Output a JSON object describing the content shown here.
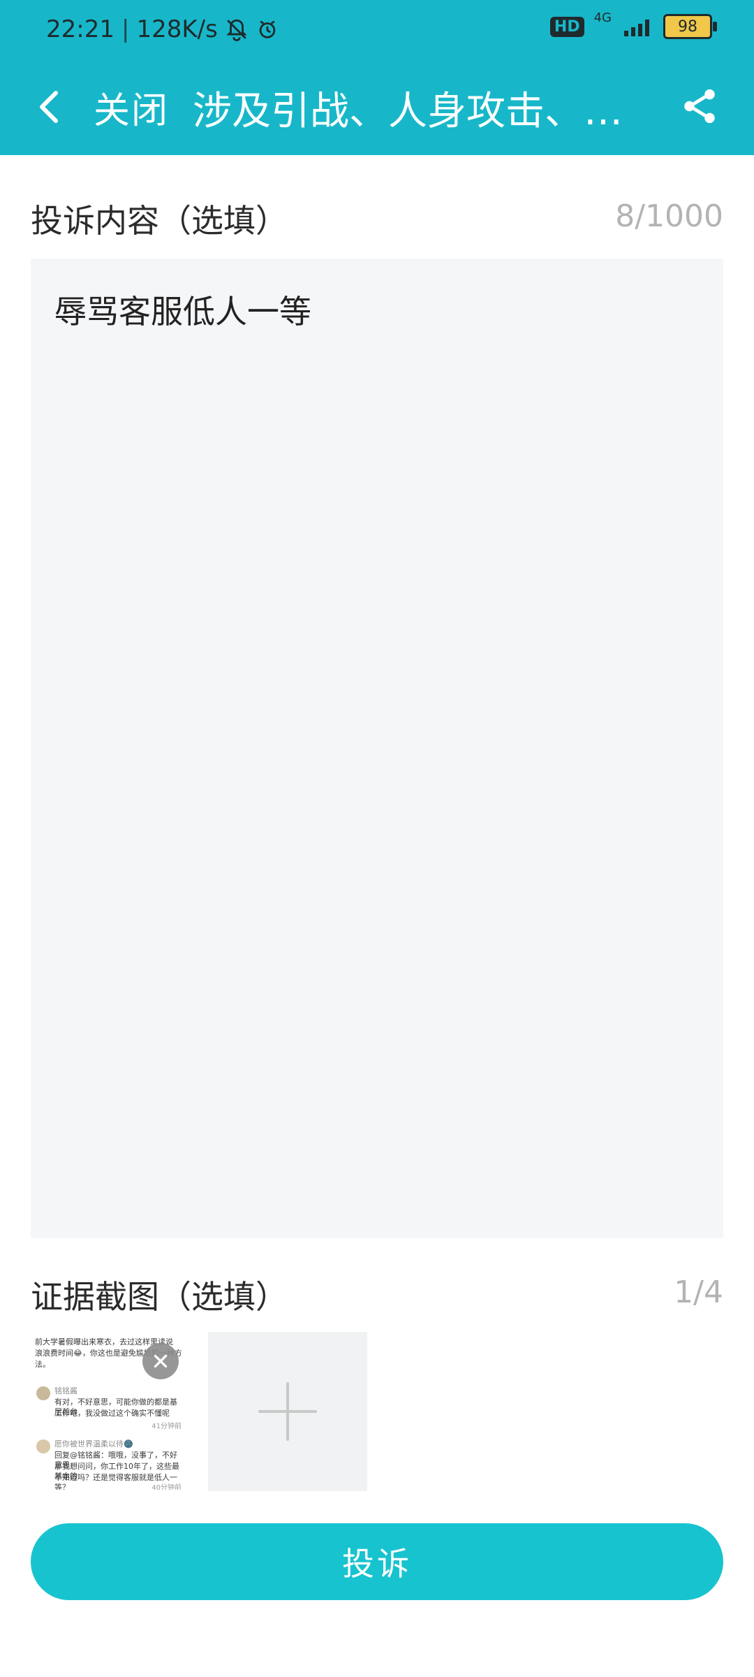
{
  "status_bar": {
    "time": "22:21",
    "speed": "128K/s",
    "hd": "HD",
    "network": "4G",
    "battery": "98",
    "icons": [
      "mute-bell-icon",
      "alarm-clock-icon",
      "signal-bars-icon",
      "battery-icon"
    ]
  },
  "header": {
    "close_label": "关闭",
    "title": "涉及引战、人身攻击、…",
    "back_icon": "chevron-left-icon",
    "share_icon": "share-icon",
    "bg_color": "#17b7c9"
  },
  "complaint": {
    "label": "投诉内容（选填）",
    "counter": "8/1000",
    "text": "辱骂客服低人一等"
  },
  "evidence": {
    "label": "证据截图（选填）",
    "counter": "1/4",
    "add_icon": "plus-icon",
    "remove_icon": "close-icon",
    "thumbnail": {
      "lines": [
        "前大学暑假曝出来寒衣，去过这样里读说",
        "浪浪费时间😂，你这也是避免尴尬的一种方",
        "法。",
        "铭铭酱",
        "有对，不好意思，可能你做的都是基层前台",
        "工作吧，我没做过这个确实不懂呢",
        "41分钟前",
        "愿你被世界温柔以待🌚",
        "回复@铭铭酱：哦哦，没事了，不好意思，",
        "那我想问问，你工作10年了，这些最基本的",
        "不知道吗？还是觉得客服就是低人一等？",
        "40分钟前"
      ]
    }
  },
  "submit": {
    "label": "投诉",
    "color": "#17c3cf"
  }
}
